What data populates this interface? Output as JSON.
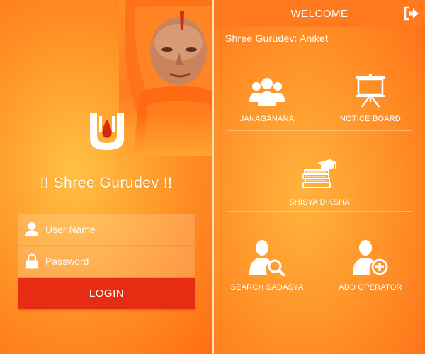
{
  "login": {
    "app_title": "!! Shree Gurudev !!",
    "username_placeholder": "User Name",
    "password_placeholder": "Password",
    "login_label": "LOGIN"
  },
  "dashboard": {
    "title": "WELCOME",
    "greeting": "Shree Gurudev: Aniket",
    "tiles": [
      {
        "label": "JANAGANANA",
        "icon": "people-group-icon"
      },
      {
        "label": "NOTICE BOARD",
        "icon": "presentation-board-icon"
      },
      {
        "label": "SHISYA DIKSHA",
        "icon": "books-graduation-cap-icon"
      },
      {
        "label": "SEARCH SADASYA",
        "icon": "user-search-icon"
      },
      {
        "label": "ADD OPERATOR",
        "icon": "user-add-icon"
      }
    ]
  },
  "colors": {
    "accent_orange": "#ff8a22",
    "login_button": "#e62d13",
    "tilak_red": "#d62a10"
  }
}
